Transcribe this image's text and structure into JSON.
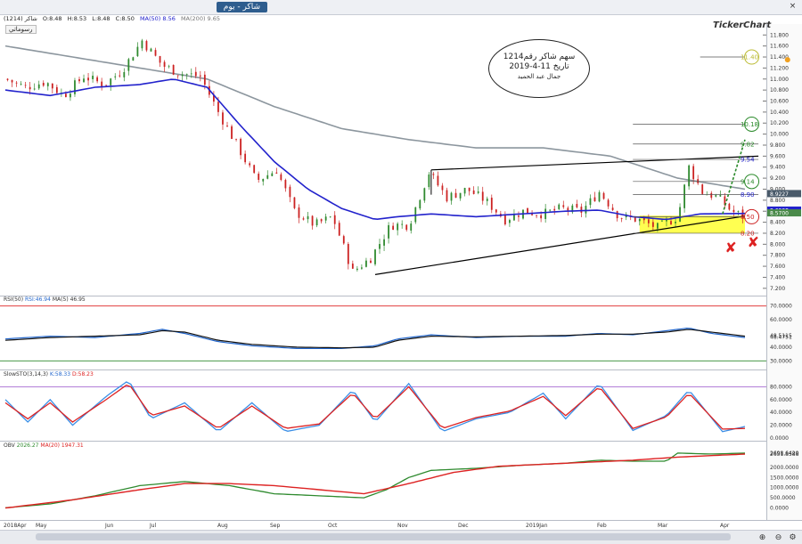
{
  "window": {
    "tab_title": "شاكر - يوم"
  },
  "quote": {
    "symbol": "شاكر (1214)",
    "open": "O:8.48",
    "high": "H:8.53",
    "low": "L:8.48",
    "close": "C:8.50",
    "ma50": "MA(50)  8.56",
    "ma200": "MA(200)  9.65",
    "mode_button": "رسوماتي"
  },
  "brand": "TickerChart",
  "annotation": {
    "line1": "سهم شاكر رقم1214",
    "line2": "تاريخ 11-4-2019",
    "line3": "جمال عبد الحميد"
  },
  "indicators": {
    "rsi": {
      "label": "RSI(50)",
      "value": "RSI:46.94",
      "ma": "MA(5)  46.95"
    },
    "stoch": {
      "label": "SlowSTO(3,14,3)",
      "k": "K:58.33",
      "d": "D:58.23"
    },
    "obv": {
      "label": "OBV",
      "value": "2026.27",
      "ma": "MA(20)  1947.31"
    }
  },
  "x_labels": [
    "2018Apr",
    "May",
    "Jun",
    "Jul",
    "Aug",
    "Sep",
    "Oct",
    "Nov",
    "Dec",
    "2019Jan",
    "Feb",
    "Mar",
    "Apr"
  ],
  "colors": {
    "price": "#000000",
    "up": "#2f8a2f",
    "down": "#cc2222",
    "ma50": "#2222cc",
    "ma200": "#8c969e",
    "rsi": "#2266cc",
    "stoch_k": "#3a8ee6",
    "stoch_d": "#dd2222",
    "obv": "#2e8a2e",
    "obv_ma": "#dd2222",
    "target": "#2a8a2a",
    "highlight": "#ffff33"
  },
  "chart_data": [
    {
      "type": "candlestick",
      "name": "price",
      "ylim": [
        7.1,
        11.95
      ],
      "y_ticks": [
        "11.800",
        "11.600",
        "11.400",
        "11.200",
        "11.000",
        "10.800",
        "10.600",
        "10.400",
        "10.200",
        "10.000",
        "9.800",
        "9.600",
        "9.400",
        "9.200",
        "9.000",
        "8.800",
        "8.600",
        "8.400",
        "8.200",
        "8.000",
        "7.800",
        "7.600",
        "7.400",
        "7.200"
      ],
      "tick_values": [
        11.8,
        11.6,
        11.4,
        11.2,
        11.0,
        10.8,
        10.6,
        10.4,
        10.2,
        10.0,
        9.8,
        9.6,
        9.4,
        9.2,
        9.0,
        8.8,
        8.6,
        8.4,
        8.2,
        8.0,
        7.8,
        7.6,
        7.4,
        7.2
      ],
      "close_points": [
        [
          0,
          11.0
        ],
        [
          9,
          10.85
        ],
        [
          18,
          10.95
        ],
        [
          26,
          10.7
        ],
        [
          35,
          11.05
        ],
        [
          44,
          10.9
        ],
        [
          52,
          11.15
        ],
        [
          61,
          11.7
        ],
        [
          70,
          11.25
        ],
        [
          78,
          11.1
        ],
        [
          87,
          11.05
        ],
        [
          95,
          10.4
        ],
        [
          104,
          9.75
        ],
        [
          112,
          9.15
        ],
        [
          121,
          9.35
        ],
        [
          129,
          8.6
        ],
        [
          138,
          8.35
        ],
        [
          146,
          8.5
        ],
        [
          155,
          7.5
        ],
        [
          163,
          7.75
        ],
        [
          172,
          8.35
        ],
        [
          180,
          8.35
        ],
        [
          189,
          9.3
        ],
        [
          197,
          8.85
        ],
        [
          206,
          9.0
        ],
        [
          214,
          8.8
        ],
        [
          223,
          8.45
        ],
        [
          231,
          8.6
        ],
        [
          240,
          8.55
        ],
        [
          248,
          8.65
        ],
        [
          257,
          8.6
        ],
        [
          265,
          8.95
        ],
        [
          274,
          8.5
        ],
        [
          282,
          8.45
        ],
        [
          291,
          8.3
        ],
        [
          300,
          8.5
        ],
        [
          305,
          9.4
        ],
        [
          311,
          8.95
        ],
        [
          318,
          8.85
        ],
        [
          324,
          8.6
        ],
        [
          330,
          8.5
        ]
      ],
      "ma50": [
        [
          0,
          10.8
        ],
        [
          20,
          10.7
        ],
        [
          40,
          10.85
        ],
        [
          60,
          10.9
        ],
        [
          75,
          11.0
        ],
        [
          90,
          10.85
        ],
        [
          105,
          10.15
        ],
        [
          120,
          9.5
        ],
        [
          135,
          9.0
        ],
        [
          150,
          8.65
        ],
        [
          165,
          8.45
        ],
        [
          175,
          8.5
        ],
        [
          190,
          8.55
        ],
        [
          210,
          8.5
        ],
        [
          230,
          8.55
        ],
        [
          250,
          8.6
        ],
        [
          265,
          8.62
        ],
        [
          280,
          8.5
        ],
        [
          295,
          8.45
        ],
        [
          310,
          8.55
        ],
        [
          330,
          8.56
        ]
      ],
      "ma200": [
        [
          0,
          11.6
        ],
        [
          30,
          11.4
        ],
        [
          60,
          11.2
        ],
        [
          90,
          11.0
        ],
        [
          120,
          10.5
        ],
        [
          150,
          10.1
        ],
        [
          180,
          9.9
        ],
        [
          210,
          9.75
        ],
        [
          240,
          9.75
        ],
        [
          270,
          9.6
        ],
        [
          300,
          9.2
        ],
        [
          330,
          9.0
        ]
      ],
      "labels": {
        "t1140": "11.40",
        "t1018": "10.18",
        "t982": "9.82",
        "t954": "9.54",
        "t914": "9.14",
        "t890": "8.90",
        "t850": "8.50",
        "t820": "8.20"
      },
      "scale_tags": [
        {
          "text": "8.9227",
          "value": 8.92,
          "color": "#4a5a6a"
        },
        {
          "text": "8.6208",
          "value": 8.62,
          "color": "#2222cc"
        },
        {
          "text": "8.5700",
          "value": 8.57,
          "color": "#4a8a4a"
        }
      ]
    },
    {
      "type": "line",
      "name": "rsi",
      "ylim": [
        25,
        75
      ],
      "y_ticks": [
        "70.0000",
        "60.0000",
        "48.5115",
        "48.4751",
        "40.0000",
        "30.0000"
      ],
      "tick_values": [
        70,
        60,
        48.5,
        47.4,
        40,
        30
      ],
      "series": [
        [
          0,
          46
        ],
        [
          20,
          48
        ],
        [
          40,
          47
        ],
        [
          60,
          50
        ],
        [
          70,
          53
        ],
        [
          80,
          50
        ],
        [
          95,
          44
        ],
        [
          110,
          41
        ],
        [
          130,
          39
        ],
        [
          150,
          39
        ],
        [
          165,
          41
        ],
        [
          175,
          46
        ],
        [
          190,
          49
        ],
        [
          210,
          47
        ],
        [
          230,
          48
        ],
        [
          250,
          48
        ],
        [
          265,
          50
        ],
        [
          280,
          49
        ],
        [
          295,
          52
        ],
        [
          305,
          54
        ],
        [
          315,
          50
        ],
        [
          330,
          47
        ]
      ],
      "ma": [
        [
          0,
          45
        ],
        [
          20,
          47
        ],
        [
          40,
          48
        ],
        [
          60,
          49
        ],
        [
          70,
          52
        ],
        [
          80,
          51
        ],
        [
          95,
          45
        ],
        [
          110,
          42
        ],
        [
          130,
          40
        ],
        [
          150,
          39.5
        ],
        [
          165,
          40
        ],
        [
          175,
          45
        ],
        [
          190,
          48
        ],
        [
          210,
          47.5
        ],
        [
          230,
          48
        ],
        [
          250,
          48.5
        ],
        [
          265,
          49.5
        ],
        [
          280,
          49.5
        ],
        [
          295,
          51
        ],
        [
          305,
          53
        ],
        [
          315,
          51
        ],
        [
          330,
          48
        ]
      ]
    },
    {
      "type": "line",
      "name": "stoch",
      "ylim": [
        0,
        100
      ],
      "y_ticks": [
        "80.0000",
        "60.0000",
        "40.0000",
        "20.0000",
        "0.0000",
        "12.8148",
        "11.5441"
      ],
      "tick_values": [
        80,
        60,
        40,
        20,
        0
      ],
      "k": [
        [
          0,
          60
        ],
        [
          10,
          25
        ],
        [
          20,
          60
        ],
        [
          30,
          20
        ],
        [
          45,
          65
        ],
        [
          55,
          90
        ],
        [
          65,
          30
        ],
        [
          80,
          55
        ],
        [
          95,
          10
        ],
        [
          110,
          55
        ],
        [
          125,
          10
        ],
        [
          140,
          20
        ],
        [
          155,
          75
        ],
        [
          165,
          25
        ],
        [
          180,
          85
        ],
        [
          195,
          10
        ],
        [
          210,
          30
        ],
        [
          225,
          40
        ],
        [
          240,
          70
        ],
        [
          250,
          30
        ],
        [
          265,
          85
        ],
        [
          280,
          12
        ],
        [
          295,
          35
        ],
        [
          305,
          75
        ],
        [
          320,
          10
        ],
        [
          330,
          18
        ]
      ],
      "d": [
        [
          0,
          55
        ],
        [
          10,
          30
        ],
        [
          20,
          55
        ],
        [
          30,
          25
        ],
        [
          45,
          60
        ],
        [
          55,
          85
        ],
        [
          65,
          35
        ],
        [
          80,
          50
        ],
        [
          95,
          15
        ],
        [
          110,
          50
        ],
        [
          125,
          15
        ],
        [
          140,
          22
        ],
        [
          155,
          70
        ],
        [
          165,
          30
        ],
        [
          180,
          80
        ],
        [
          195,
          15
        ],
        [
          210,
          32
        ],
        [
          225,
          42
        ],
        [
          240,
          65
        ],
        [
          250,
          35
        ],
        [
          265,
          80
        ],
        [
          280,
          15
        ],
        [
          295,
          33
        ],
        [
          305,
          70
        ],
        [
          320,
          14
        ],
        [
          330,
          15
        ]
      ]
    },
    {
      "type": "line",
      "name": "obv",
      "ylim": [
        -500,
        3000
      ],
      "y_ticks": [
        "2698.6420",
        "2651.8588",
        "2000.0000",
        "1500.0000",
        "1000.0000",
        "500.0000",
        "0.0000"
      ],
      "tick_values": [
        2700,
        2652,
        2000,
        1500,
        1000,
        500,
        0
      ],
      "series": [
        [
          0,
          10
        ],
        [
          20,
          200
        ],
        [
          40,
          600
        ],
        [
          60,
          1100
        ],
        [
          80,
          1300
        ],
        [
          100,
          1100
        ],
        [
          120,
          700
        ],
        [
          140,
          600
        ],
        [
          160,
          500
        ],
        [
          170,
          900
        ],
        [
          180,
          1500
        ],
        [
          190,
          1850
        ],
        [
          210,
          1950
        ],
        [
          230,
          2100
        ],
        [
          250,
          2200
        ],
        [
          265,
          2350
        ],
        [
          280,
          2300
        ],
        [
          295,
          2300
        ],
        [
          300,
          2700
        ],
        [
          315,
          2650
        ],
        [
          330,
          2700
        ]
      ],
      "ma": [
        [
          0,
          0
        ],
        [
          30,
          400
        ],
        [
          60,
          900
        ],
        [
          80,
          1200
        ],
        [
          100,
          1200
        ],
        [
          120,
          1100
        ],
        [
          140,
          900
        ],
        [
          160,
          700
        ],
        [
          180,
          1200
        ],
        [
          200,
          1750
        ],
        [
          220,
          2050
        ],
        [
          250,
          2200
        ],
        [
          280,
          2350
        ],
        [
          300,
          2500
        ],
        [
          330,
          2650
        ]
      ]
    }
  ]
}
